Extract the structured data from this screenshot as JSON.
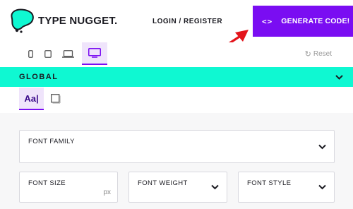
{
  "header": {
    "brand": "TYPE NUGGET.",
    "nav_link": "LOGIN / REGISTER",
    "generate_button": {
      "icon": "code-icon",
      "icon_glyph": "<>",
      "label": "GENERATE CODE!"
    },
    "accent_color": "#7a0df2"
  },
  "toolbar": {
    "devices": [
      {
        "name": "phone",
        "icon": "phone-icon",
        "active": false
      },
      {
        "name": "tablet",
        "icon": "tablet-icon",
        "active": false
      },
      {
        "name": "laptop",
        "icon": "laptop-icon",
        "active": false
      },
      {
        "name": "desktop",
        "icon": "desktop-icon",
        "active": true
      }
    ],
    "reset_label": "Reset"
  },
  "global_bar": {
    "title": "GLOBAL",
    "color": "#0ff8d2"
  },
  "tabs": [
    {
      "label": "Aa|",
      "active": true
    },
    {
      "icon": "square-icon",
      "active": false
    }
  ],
  "fields": {
    "font_family": {
      "label": "FONT FAMILY"
    },
    "font_size": {
      "label": "FONT SIZE",
      "suffix": "px"
    },
    "font_weight": {
      "label": "FONT WEIGHT"
    },
    "font_style": {
      "label": "FONT STYLE"
    }
  }
}
